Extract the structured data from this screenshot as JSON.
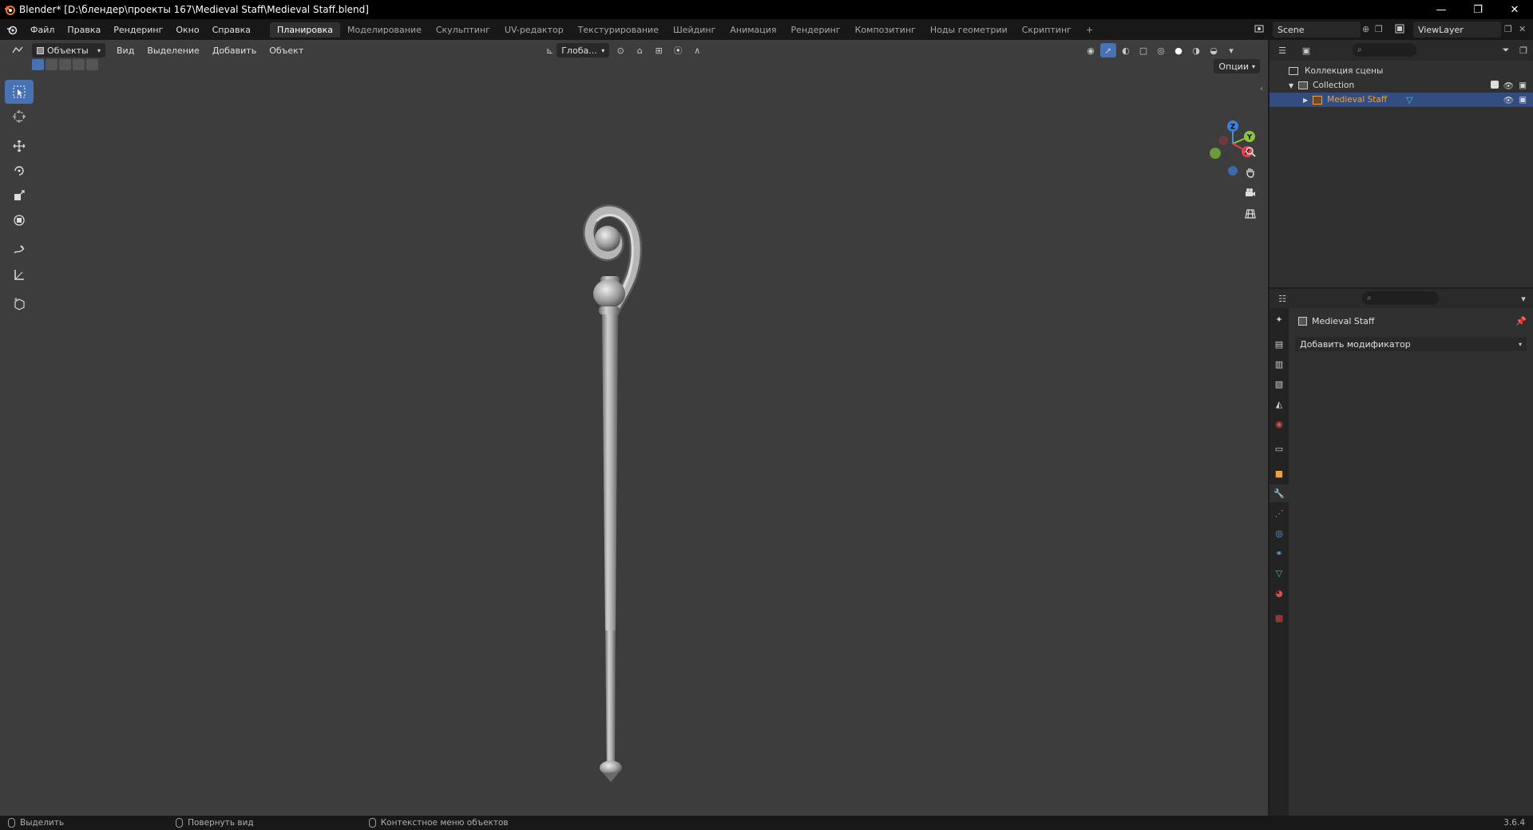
{
  "window": {
    "title": "Blender* [D:\\блендер\\проекты 167\\Medieval Staff\\Medieval Staff.blend]"
  },
  "menu": {
    "items": [
      "Файл",
      "Правка",
      "Рендеринг",
      "Окно",
      "Справка"
    ]
  },
  "workspaces": {
    "tabs": [
      "Планировка",
      "Моделирование",
      "Скульптинг",
      "UV-редактор",
      "Текстурирование",
      "Шейдинг",
      "Анимация",
      "Рендеринг",
      "Композитинг",
      "Ноды геометрии",
      "Скриптинг"
    ],
    "active": "Планировка",
    "add_label": "+"
  },
  "scene": {
    "name": "Scene"
  },
  "view_layer": {
    "name": "ViewLayer"
  },
  "viewport_header": {
    "mode": "Объекты",
    "menus": [
      "Вид",
      "Выделение",
      "Добавить",
      "Объект"
    ],
    "transform_orientation": "Глоба...",
    "options_label": "Опции"
  },
  "gizmo": {
    "x": "X",
    "y": "Y",
    "z": "Z"
  },
  "outliner": {
    "scene_collection": "Коллекция сцены",
    "collection": "Collection",
    "object": "Medieval Staff"
  },
  "properties": {
    "object_name": "Medieval Staff",
    "add_modifier": "Добавить модификатор"
  },
  "statusbar": {
    "select": "Выделить",
    "rotate": "Повернуть вид",
    "context_menu": "Контекстное меню объектов",
    "version": "3.6.4"
  },
  "colors": {
    "accent": "#4772b3",
    "selected_row": "#334d80",
    "object_name_color": "#f0a040",
    "viewport_bg": "#3d3d3d"
  }
}
